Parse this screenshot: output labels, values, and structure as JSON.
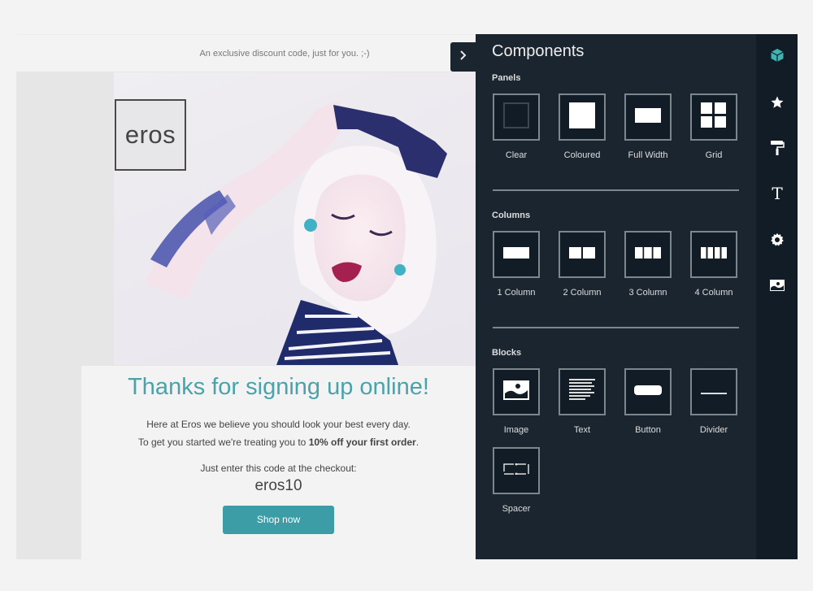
{
  "email": {
    "preheader": "An exclusive discount code, just for you. ;-)",
    "logo_text": "eros",
    "hero_image_alt": "woman-with-sunglasses-photo",
    "headline": "Thanks for signing up online!",
    "body_line1": "Here at Eros we believe you should look your best every day.",
    "body_line2_prefix": "To get you started we're treating you to ",
    "body_line2_bold": "10% off your first order",
    "body_line2_suffix": ".",
    "code_label": "Just enter this code at the checkout:",
    "code": "eros10",
    "cta_label": "Shop now",
    "accent_color": "#3d9da7",
    "headline_color": "#4aa3ab"
  },
  "panel": {
    "toggle_icon": "chevron-right-icon",
    "title": "Components",
    "sections": [
      {
        "label": "Panels",
        "items": [
          {
            "label": "Clear",
            "icon": "clear-panel-icon"
          },
          {
            "label": "Coloured",
            "icon": "coloured-panel-icon"
          },
          {
            "label": "Full Width",
            "icon": "full-width-panel-icon"
          },
          {
            "label": "Grid",
            "icon": "grid-panel-icon"
          }
        ]
      },
      {
        "label": "Columns",
        "items": [
          {
            "label": "1 Column",
            "icon": "one-column-icon"
          },
          {
            "label": "2 Column",
            "icon": "two-column-icon"
          },
          {
            "label": "3 Column",
            "icon": "three-column-icon"
          },
          {
            "label": "4 Column",
            "icon": "four-column-icon"
          }
        ]
      },
      {
        "label": "Blocks",
        "items": [
          {
            "label": "Image",
            "icon": "image-block-icon"
          },
          {
            "label": "Text",
            "icon": "text-block-icon"
          },
          {
            "label": "Button",
            "icon": "button-block-icon"
          },
          {
            "label": "Divider",
            "icon": "divider-block-icon"
          },
          {
            "label": "Spacer",
            "icon": "spacer-block-icon"
          }
        ]
      }
    ]
  },
  "rail": {
    "items": [
      {
        "name": "components",
        "icon": "cube-icon",
        "active": true,
        "color": "#3fb4b0"
      },
      {
        "name": "favourites",
        "icon": "star-icon"
      },
      {
        "name": "styles",
        "icon": "paint-roller-icon"
      },
      {
        "name": "typography",
        "icon": "text-icon"
      },
      {
        "name": "settings",
        "icon": "gear-icon"
      },
      {
        "name": "images",
        "icon": "image-icon"
      }
    ]
  }
}
